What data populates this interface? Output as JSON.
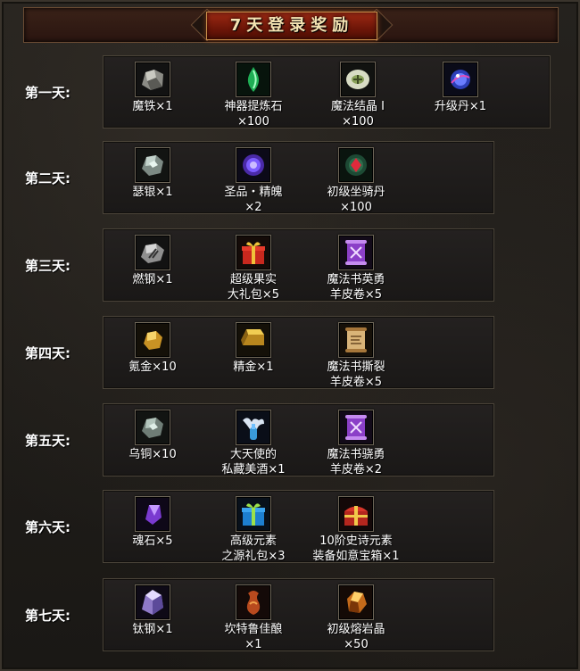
{
  "title": "7天登录奖励",
  "days": [
    {
      "label": "第一天:",
      "items": [
        {
          "name": "魔铁×1",
          "icon": "iron-ore-icon"
        },
        {
          "name": "神器提炼石\n×100",
          "icon": "green-crystal-icon"
        },
        {
          "name": "魔法结晶 I\n×100",
          "icon": "rune-stone-icon"
        },
        {
          "name": "升级丹×1",
          "icon": "blue-orb-icon"
        }
      ]
    },
    {
      "label": "第二天:",
      "items": [
        {
          "name": "瑟银×1",
          "icon": "silver-ore-icon"
        },
        {
          "name": "圣品・精魄\n×2",
          "icon": "purple-orb-icon"
        },
        {
          "name": "初级坐骑丹\n×100",
          "icon": "red-gem-orb-icon"
        }
      ]
    },
    {
      "label": "第三天:",
      "items": [
        {
          "name": "燃钢×1",
          "icon": "steel-ore-icon"
        },
        {
          "name": "超级果实\n大礼包×5",
          "icon": "gift-box-red-icon"
        },
        {
          "name": "魔法书英勇\n羊皮卷×5",
          "icon": "purple-scroll-icon"
        }
      ]
    },
    {
      "label": "第四天:",
      "items": [
        {
          "name": "氪金×10",
          "icon": "gold-nugget-icon"
        },
        {
          "name": "精金×1",
          "icon": "gold-bar-icon"
        },
        {
          "name": "魔法书撕裂\n羊皮卷×5",
          "icon": "parchment-scroll-icon"
        }
      ]
    },
    {
      "label": "第五天:",
      "items": [
        {
          "name": "乌铜×10",
          "icon": "copper-ore-icon"
        },
        {
          "name": "大天使的\n私藏美酒×1",
          "icon": "angel-wine-icon"
        },
        {
          "name": "魔法书骁勇\n羊皮卷×2",
          "icon": "purple-scroll-icon"
        }
      ]
    },
    {
      "label": "第六天:",
      "items": [
        {
          "name": "魂石×5",
          "icon": "soul-stone-icon"
        },
        {
          "name": "高级元素\n之源礼包×3",
          "icon": "gift-box-blue-icon"
        },
        {
          "name": "10阶史诗元素\n装备如意宝箱×1",
          "icon": "treasure-chest-icon"
        }
      ]
    },
    {
      "label": "第七天:",
      "items": [
        {
          "name": "钛钢×1",
          "icon": "titanium-crystal-icon"
        },
        {
          "name": "坎特鲁佳酿\n×1",
          "icon": "wine-gourd-icon"
        },
        {
          "name": "初级熔岩晶\n×50",
          "icon": "lava-crystal-icon"
        }
      ]
    }
  ]
}
